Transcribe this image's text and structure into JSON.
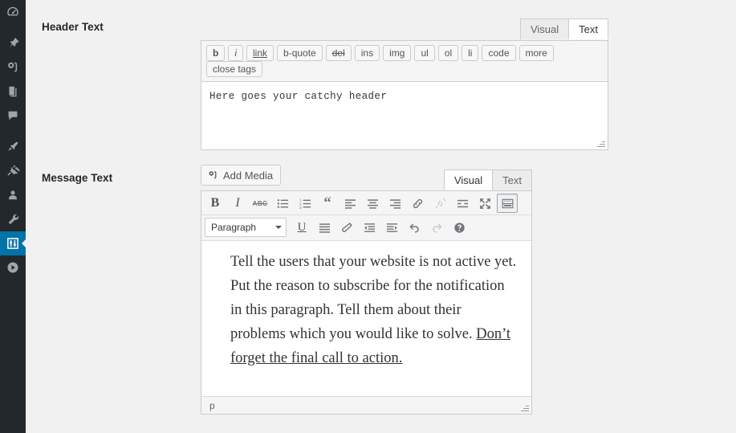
{
  "sidebar": {
    "items": [
      {
        "name": "dashboard",
        "icon": "dashboard-gauge-icon",
        "current": false
      },
      {
        "name": "posts",
        "icon": "pin-icon",
        "current": false
      },
      {
        "name": "media",
        "icon": "camera-icon",
        "current": false
      },
      {
        "name": "pages",
        "icon": "pages-icon",
        "current": false
      },
      {
        "name": "comments",
        "icon": "comment-bubble-icon",
        "current": false
      },
      {
        "name": "appearance",
        "icon": "paintbrush-icon",
        "current": false
      },
      {
        "name": "plugins",
        "icon": "plug-icon",
        "current": false
      },
      {
        "name": "users",
        "icon": "user-icon",
        "current": false
      },
      {
        "name": "tools",
        "icon": "wrench-icon",
        "current": false
      },
      {
        "name": "settings",
        "icon": "sliders-icon",
        "current": true
      },
      {
        "name": "collapse",
        "icon": "play-circle-icon",
        "current": false
      }
    ],
    "current_color": "#0073aa"
  },
  "header_field": {
    "label": "Header Text",
    "tabs": [
      {
        "label": "Visual",
        "active": false
      },
      {
        "label": "Text",
        "active": true
      }
    ],
    "quicktags": [
      {
        "label": "b",
        "style": "b"
      },
      {
        "label": "i",
        "style": "i"
      },
      {
        "label": "link",
        "style": "u"
      },
      {
        "label": "b-quote",
        "style": ""
      },
      {
        "label": "del",
        "style": "s"
      },
      {
        "label": "ins",
        "style": ""
      },
      {
        "label": "img",
        "style": ""
      },
      {
        "label": "ul",
        "style": ""
      },
      {
        "label": "ol",
        "style": ""
      },
      {
        "label": "li",
        "style": ""
      },
      {
        "label": "code",
        "style": ""
      },
      {
        "label": "more",
        "style": ""
      },
      {
        "label": "close tags",
        "style": ""
      }
    ],
    "value": "Here goes your catchy header",
    "placeholder": ""
  },
  "message_field": {
    "label": "Message Text",
    "add_media_label": "Add Media",
    "tabs": [
      {
        "label": "Visual",
        "active": true
      },
      {
        "label": "Text",
        "active": false
      }
    ],
    "toolbar_row1": [
      {
        "name": "bold",
        "icon": "bold-icon",
        "state": "normal"
      },
      {
        "name": "italic",
        "icon": "italic-icon",
        "state": "normal"
      },
      {
        "name": "strikethrough",
        "icon": "strikethrough-icon",
        "state": "normal"
      },
      {
        "name": "bulleted-list",
        "icon": "bulleted-list-icon",
        "state": "normal"
      },
      {
        "name": "numbered-list",
        "icon": "numbered-list-icon",
        "state": "normal"
      },
      {
        "name": "blockquote",
        "icon": "blockquote-icon",
        "state": "normal"
      },
      {
        "name": "align-left",
        "icon": "align-left-icon",
        "state": "normal"
      },
      {
        "name": "align-center",
        "icon": "align-center-icon",
        "state": "normal"
      },
      {
        "name": "align-right",
        "icon": "align-right-icon",
        "state": "normal"
      },
      {
        "name": "insert-link",
        "icon": "link-icon",
        "state": "normal"
      },
      {
        "name": "remove-link",
        "icon": "unlink-icon",
        "state": "disabled"
      },
      {
        "name": "read-more",
        "icon": "read-more-icon",
        "state": "normal"
      },
      {
        "name": "fullscreen",
        "icon": "fullscreen-icon",
        "state": "normal"
      },
      {
        "name": "toolbar-toggle",
        "icon": "kitchen-sink-icon",
        "state": "pressed"
      }
    ],
    "format_select": {
      "value": "Paragraph"
    },
    "toolbar_row2": [
      {
        "name": "underline",
        "icon": "underline-icon",
        "state": "normal"
      },
      {
        "name": "justify",
        "icon": "align-justify-icon",
        "state": "normal"
      },
      {
        "name": "clear-formatting",
        "icon": "eraser-icon",
        "state": "normal"
      },
      {
        "name": "outdent",
        "icon": "outdent-icon",
        "state": "normal"
      },
      {
        "name": "indent",
        "icon": "indent-icon",
        "state": "normal"
      },
      {
        "name": "undo",
        "icon": "undo-icon",
        "state": "normal"
      },
      {
        "name": "redo",
        "icon": "redo-icon",
        "state": "disabled"
      },
      {
        "name": "keyboard-help",
        "icon": "help-circle-icon",
        "state": "normal"
      }
    ],
    "body_text": "Tell the users that your website is not active yet. Put the reason to subscribe for the notification in this paragraph. Tell them about their problems which you would like to solve. ",
    "body_cta": "Don’t forget the final call to action.",
    "status_path": "p"
  }
}
